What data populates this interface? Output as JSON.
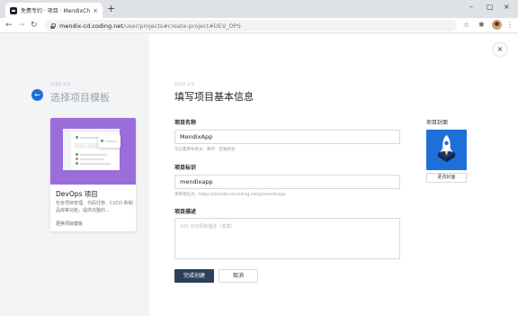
{
  "browser": {
    "tab_title": "免费专约 · 项目 · MendixChengdu",
    "tab_close": "×",
    "new_tab": "+",
    "window_controls": [
      "–",
      "▢",
      "×"
    ],
    "url_host": "mendix-cd.coding.net",
    "url_path": "/user/projects#create-project#DEV_OPS",
    "icons": [
      "back-icon",
      "forward-icon",
      "reload-icon",
      "lock-icon",
      "star-icon",
      "extension-icon",
      "puzzle-icon",
      "profile-avatar",
      "menu-icon"
    ]
  },
  "left": {
    "step": "STEP 1/2",
    "title": "选择项目模板",
    "back_icon": "←",
    "template_card": {
      "title": "DevOps 项目",
      "description": "包含项目管理、代码托管、CI/CD 和制品库等功能，提供完整的...",
      "link": "更换项目模板"
    }
  },
  "right": {
    "step": "STEP 2/2",
    "title": "填写项目基本信息",
    "close_icon": "×",
    "name": {
      "label": "项目名称",
      "value": "MendixApp",
      "hint": "可以使用中英文、数字、空格组合"
    },
    "identifier": {
      "label": "项目标识",
      "value": "mendixapp",
      "hint": "项目地址为：https://mendix-cd.coding.net/p/mendixapp"
    },
    "description": {
      "label": "项目描述",
      "placeholder": "100 字内项目描述（选填）"
    },
    "cover": {
      "label": "项目封面",
      "change_button": "更改封面"
    },
    "submit_button": "完成创建",
    "cancel_button": "取消"
  },
  "colors": {
    "accent": "#1e6fd9",
    "card_bg": "#9b6dda",
    "primary_button": "#2d3f59",
    "left_bg": "#f3f4f6"
  }
}
